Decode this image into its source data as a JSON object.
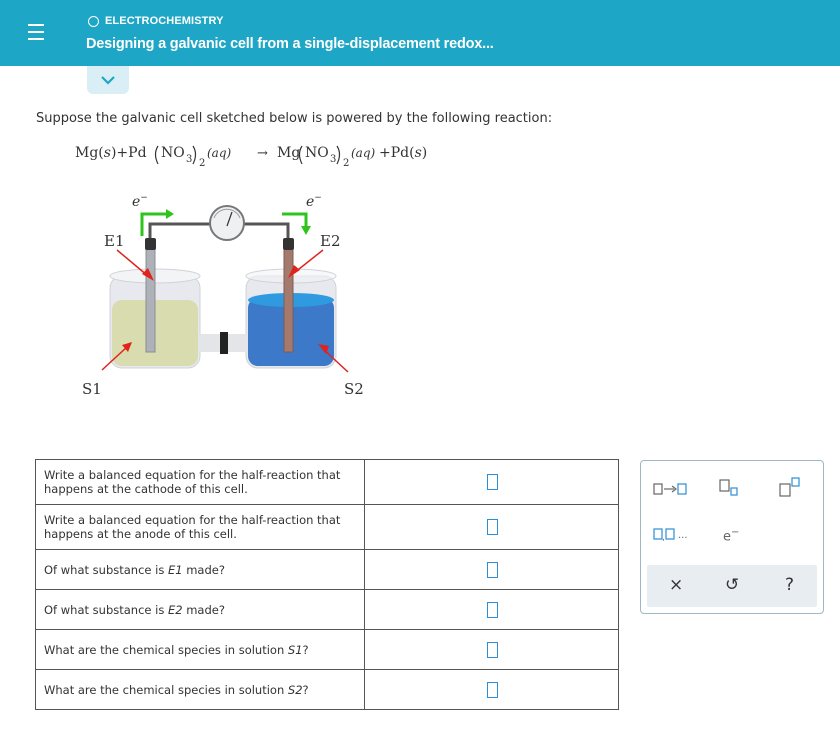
{
  "header": {
    "topic": "ELECTROCHEMISTRY",
    "title": "Designing a galvanic cell from a single-displacement redox..."
  },
  "prompt": "Suppose the galvanic cell sketched below is powered by the following reaction:",
  "equation": {
    "left": "Mg(s)+Pd(NO3)2(aq)",
    "arrow": "→",
    "right": "Mg(NO3)2(aq)+Pd(s)"
  },
  "diagram": {
    "electron_left": "e",
    "electron_right": "e",
    "electron_sup": "−",
    "E1": "E1",
    "E2": "E2",
    "S1": "S1",
    "S2": "S2",
    "colors": {
      "solution_left": "#d9dcae",
      "solution_right": "#2f7ecf",
      "arrow_red": "#e0231b",
      "arrow_green": "#2fc41c"
    }
  },
  "questions": [
    {
      "text": "Write a balanced equation for the half-reaction that happens at the cathode of this cell."
    },
    {
      "text": "Write a balanced equation for the half-reaction that happens at the anode of this cell."
    },
    {
      "text_pre": "Of what substance is ",
      "italic": "E1",
      "text_post": " made?"
    },
    {
      "text_pre": "Of what substance is ",
      "italic": "E2",
      "text_post": " made?"
    },
    {
      "text_pre": "What are the chemical species in solution ",
      "italic": "S1",
      "text_post": "?"
    },
    {
      "text_pre": "What are the chemical species in solution ",
      "italic": "S2",
      "text_post": "?"
    }
  ],
  "palette": {
    "row2_ellipsis": "...",
    "electron": "e",
    "electron_sup": "−",
    "clear": "×",
    "undo": "↺",
    "help": "?",
    "accent": "#2b8ed6"
  }
}
